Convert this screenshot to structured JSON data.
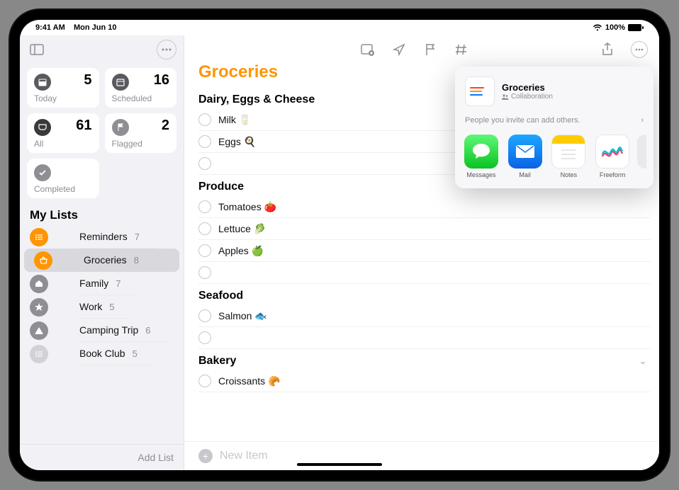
{
  "statusbar": {
    "time": "9:41 AM",
    "date": "Mon Jun 10",
    "battery": "100%"
  },
  "sidebar": {
    "smart": {
      "today": {
        "label": "Today",
        "count": "5"
      },
      "scheduled": {
        "label": "Scheduled",
        "count": "16"
      },
      "all": {
        "label": "All",
        "count": "61"
      },
      "flagged": {
        "label": "Flagged",
        "count": "2"
      },
      "completed": {
        "label": "Completed"
      }
    },
    "section": "My Lists",
    "lists": [
      {
        "name": "Reminders",
        "count": "7",
        "color": "#ff9500"
      },
      {
        "name": "Groceries",
        "count": "8",
        "color": "#ff9500"
      },
      {
        "name": "Family",
        "count": "7",
        "color": "#8e8e93"
      },
      {
        "name": "Work",
        "count": "5",
        "color": "#8e8e93"
      },
      {
        "name": "Camping Trip",
        "count": "6",
        "color": "#8e8e93"
      },
      {
        "name": "Book Club",
        "count": "5",
        "color": "#d1d1d6"
      }
    ],
    "add_list": "Add List"
  },
  "main": {
    "title": "Groceries",
    "groups": [
      {
        "name": "Dairy, Eggs & Cheese",
        "items": [
          "Milk 🥛",
          "Eggs 🍳"
        ]
      },
      {
        "name": "Produce",
        "items": [
          "Tomatoes 🍅",
          "Lettuce 🥬",
          "Apples 🍏"
        ]
      },
      {
        "name": "Seafood",
        "items": [
          "Salmon 🐟"
        ]
      },
      {
        "name": "Bakery",
        "items": [
          "Croissants 🥐"
        ]
      }
    ],
    "new_item": "New Item"
  },
  "share": {
    "title": "Groceries",
    "mode": "Collaboration",
    "invite": "People you invite can add others.",
    "apps": [
      {
        "label": "Messages"
      },
      {
        "label": "Mail"
      },
      {
        "label": "Notes"
      },
      {
        "label": "Freeform"
      }
    ]
  }
}
